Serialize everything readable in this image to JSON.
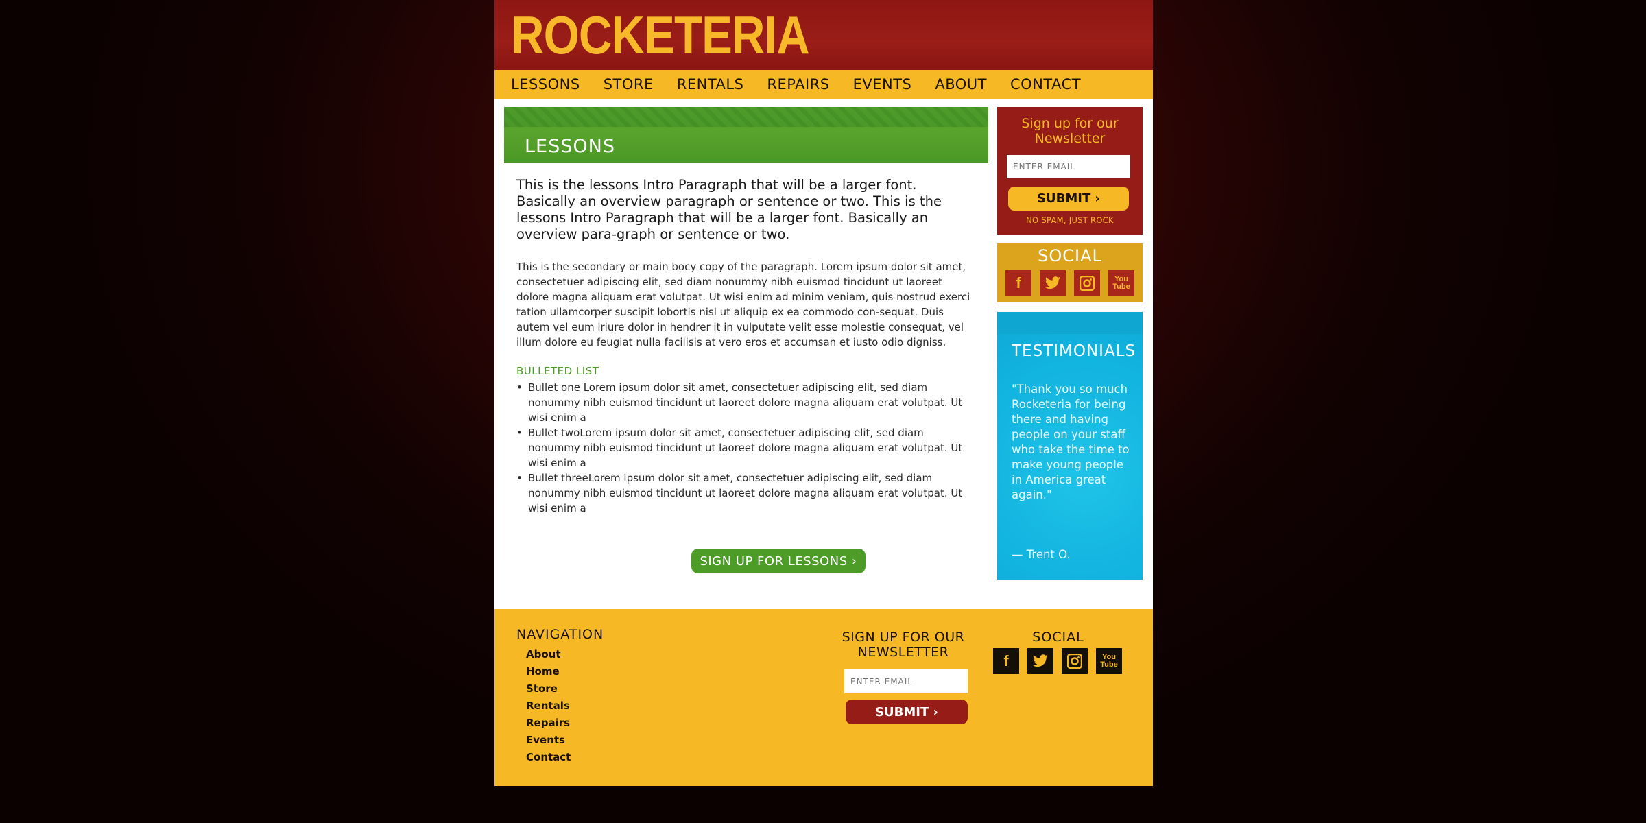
{
  "brand": {
    "logo": "ROCKETERIA"
  },
  "nav": [
    "LESSONS",
    "STORE",
    "RENTALS",
    "REPAIRS",
    "EVENTS",
    "ABOUT",
    "CONTACT"
  ],
  "main": {
    "section_title": "LESSONS",
    "intro": "This is the lessons Intro Paragraph that will be a larger font. Basically an overview paragraph or sentence or two. This is the lessons Intro Paragraph that will be a larger font. Basically an overview para-graph or sentence or two.",
    "body": "This is the secondary or main bocy copy of the paragraph. Lorem ipsum dolor sit amet, consectetuer adipiscing elit, sed diam nonummy nibh euismod tincidunt ut laoreet dolore magna aliquam erat volutpat.  Ut wisi enim ad minim veniam, quis nostrud exerci tation ullamcorper suscipit lobortis nisl ut aliquip ex ea commodo con-sequat.  Duis autem vel eum iriure dolor in hendrer it in vulputate velit esse molestie consequat, vel illum dolore eu feugiat nulla facilisis at vero eros et accumsan et iusto odio digniss.",
    "list_heading": "BULLETED LIST",
    "bullets": [
      "Bullet one Lorem ipsum dolor sit amet, consectetuer adipiscing elit, sed diam nonummy nibh euismod tincidunt ut laoreet dolore magna aliquam erat volutpat. Ut wisi enim a",
      "Bullet twoLorem ipsum dolor sit amet, consectetuer adipiscing elit, sed diam nonummy nibh euismod tincidunt ut laoreet dolore magna aliquam erat volutpat. Ut wisi enim a",
      "Bullet threeLorem ipsum dolor sit amet, consectetuer adipiscing elit, sed diam nonummy nibh euismod tincidunt ut laoreet dolore magna aliquam erat volutpat. Ut wisi enim a"
    ],
    "cta": "SIGN UP FOR LESSONS  ›"
  },
  "sidebar": {
    "newsletter": {
      "title": "Sign up for our Newsletter",
      "placeholder": "ENTER EMAIL",
      "submit": "SUBMIT  ›",
      "note": "NO SPAM, JUST ROCK"
    },
    "social_title": "SOCIAL",
    "testimonials": {
      "title": "TESTIMONIALS",
      "quote": "\"Thank you so much Rocketeria for being there and having people on your staff who take the time to make young people in America great again.\"",
      "author": "— Trent O."
    }
  },
  "footer": {
    "nav_title": "NAVIGATION",
    "nav_items": [
      "About",
      "Home",
      "Store",
      "Rentals",
      "Repairs",
      "Events",
      "Contact"
    ],
    "newsletter_title": "SIGN UP FOR OUR NEWSLETTER",
    "placeholder": "ENTER EMAIL",
    "submit": "SUBMIT  ›",
    "social_title": "SOCIAL"
  },
  "icons": [
    "facebook-icon",
    "twitter-icon",
    "instagram-icon",
    "youtube-icon"
  ],
  "colors": {
    "yellow": "#f6b824",
    "red": "#961c17",
    "green": "#4c9c27",
    "cyan": "#12b4e0"
  }
}
